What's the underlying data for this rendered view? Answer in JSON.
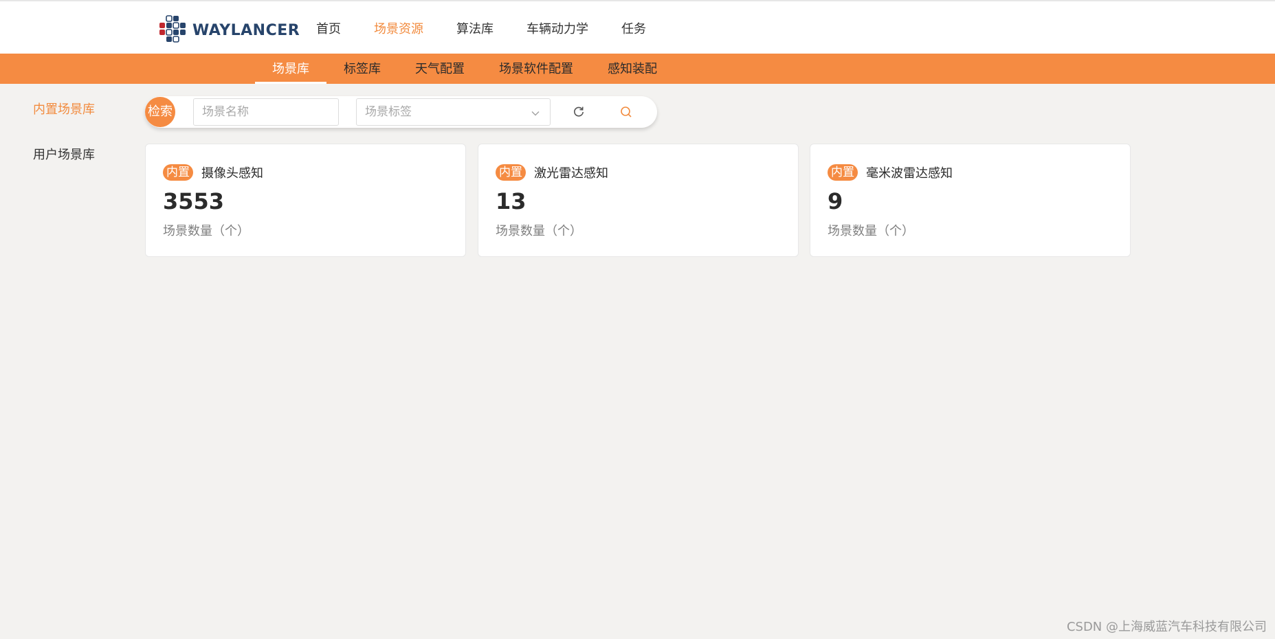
{
  "header": {
    "logo_text": "WAYLANCER",
    "nav": [
      {
        "label": "首页"
      },
      {
        "label": "场景资源"
      },
      {
        "label": "算法库"
      },
      {
        "label": "车辆动力学"
      },
      {
        "label": "任务"
      }
    ],
    "active_index": 1
  },
  "subnav": {
    "items": [
      {
        "label": "场景库"
      },
      {
        "label": "标签库"
      },
      {
        "label": "天气配置"
      },
      {
        "label": "场景软件配置"
      },
      {
        "label": "感知装配"
      }
    ],
    "active_index": 0
  },
  "sidebar": {
    "items": [
      {
        "label": "内置场景库"
      },
      {
        "label": "用户场景库"
      }
    ],
    "active_index": 0
  },
  "search": {
    "badge": "检索",
    "name_placeholder": "场景名称",
    "name_value": "",
    "tag_placeholder": "场景标签"
  },
  "cards": [
    {
      "tag": "内置",
      "title": "摄像头感知",
      "count": "3553",
      "unit": "场景数量（个）"
    },
    {
      "tag": "内置",
      "title": "激光雷达感知",
      "count": "13",
      "unit": "场景数量（个）"
    },
    {
      "tag": "内置",
      "title": "毫米波雷达感知",
      "count": "9",
      "unit": "场景数量（个）"
    }
  ],
  "watermark": "CSDN @上海威蓝汽车科技有限公司",
  "colors": {
    "accent": "#f58b42",
    "brand_text": "#27446b",
    "background": "#f3f2f0"
  },
  "icons": {
    "reset": "refresh-icon",
    "search": "search-icon",
    "dropdown": "chevron-down-icon",
    "logo": "waylancer-logo-icon"
  }
}
